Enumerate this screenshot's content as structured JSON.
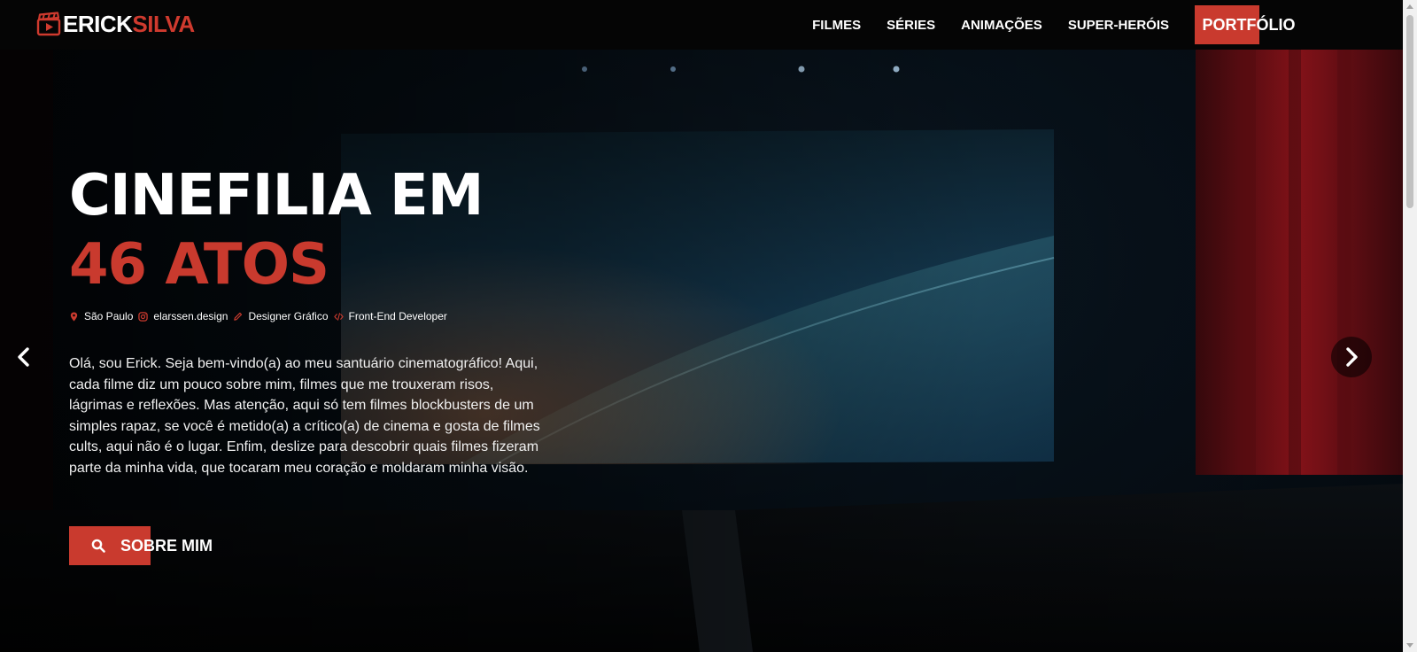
{
  "header": {
    "logo": {
      "first": "ERICK",
      "second": "SILVA",
      "icon": "clapperboard-icon"
    },
    "nav": [
      {
        "label": "FILMES"
      },
      {
        "label": "SÉRIES"
      },
      {
        "label": "ANIMAÇÕES"
      },
      {
        "label": "SUPER-HERÓIS"
      }
    ],
    "cta": "PORTFÓLIO"
  },
  "hero": {
    "title_line1": "CINEFILIA EM",
    "title_line2": "46 ATOS",
    "meta": [
      {
        "icon": "location-pin-icon",
        "label": "São Paulo"
      },
      {
        "icon": "instagram-icon",
        "label": "elarssen.design"
      },
      {
        "icon": "pencil-icon",
        "label": "Designer Gráfico"
      },
      {
        "icon": "code-icon",
        "label": "Front-End Developer"
      }
    ],
    "intro": "Olá, sou Erick. Seja bem-vindo(a) ao meu santuário cinematográfico! Aqui, cada filme diz um pouco sobre mim, filmes que me trouxeram risos, lágrimas e reflexões. Mas atenção, aqui só tem filmes blockbusters de um simples rapaz, se você é metido(a) a crítico(a) de cinema e gosta de filmes cults, aqui não é o lugar. Enfim, deslize para descobrir quais filmes fizeram parte da minha vida, que tocaram meu coração e moldaram minha visão.",
    "button": {
      "label": "SOBRE MIM",
      "icon": "search-icon"
    }
  },
  "carousel": {
    "prev_icon": "chevron-left-icon",
    "next_icon": "chevron-right-icon"
  },
  "colors": {
    "accent": "#c93a2e",
    "header_bg": "#050505",
    "text": "#ffffff"
  }
}
